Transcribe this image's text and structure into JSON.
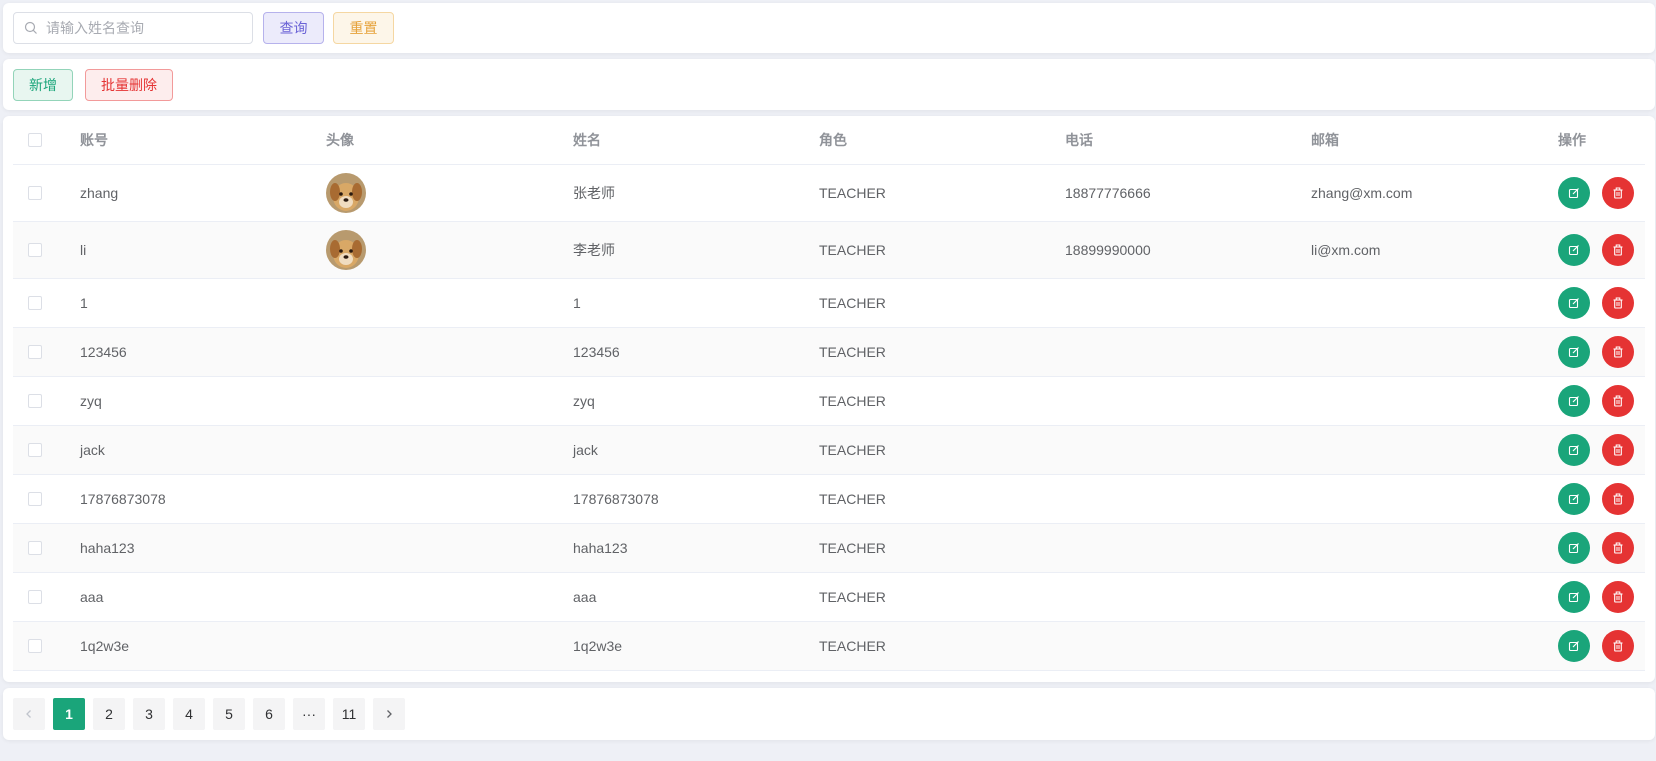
{
  "search": {
    "placeholder": "请输入姓名查询",
    "value": "",
    "search_label": "查询",
    "reset_label": "重置"
  },
  "actions": {
    "add_label": "新增",
    "batch_delete_label": "批量删除"
  },
  "table": {
    "columns": [
      "账号",
      "头像",
      "姓名",
      "角色",
      "电话",
      "邮箱",
      "操作"
    ],
    "rows": [
      {
        "account": "zhang",
        "avatar": "dog-photo",
        "name": "张老师",
        "role": "TEACHER",
        "phone": "18877776666",
        "email": "zhang@xm.com"
      },
      {
        "account": "li",
        "avatar": "dog-photo",
        "name": "李老师",
        "role": "TEACHER",
        "phone": "18899990000",
        "email": "li@xm.com"
      },
      {
        "account": "1",
        "avatar": "",
        "name": "1",
        "role": "TEACHER",
        "phone": "",
        "email": ""
      },
      {
        "account": "123456",
        "avatar": "",
        "name": "123456",
        "role": "TEACHER",
        "phone": "",
        "email": ""
      },
      {
        "account": "zyq",
        "avatar": "",
        "name": "zyq",
        "role": "TEACHER",
        "phone": "",
        "email": ""
      },
      {
        "account": "jack",
        "avatar": "",
        "name": "jack",
        "role": "TEACHER",
        "phone": "",
        "email": ""
      },
      {
        "account": "17876873078",
        "avatar": "",
        "name": "17876873078",
        "role": "TEACHER",
        "phone": "",
        "email": ""
      },
      {
        "account": "haha123",
        "avatar": "",
        "name": "haha123",
        "role": "TEACHER",
        "phone": "",
        "email": ""
      },
      {
        "account": "aaa",
        "avatar": "",
        "name": "aaa",
        "role": "TEACHER",
        "phone": "",
        "email": ""
      },
      {
        "account": "1q2w3e",
        "avatar": "",
        "name": "1q2w3e",
        "role": "TEACHER",
        "phone": "",
        "email": ""
      }
    ]
  },
  "pagination": {
    "pages": [
      "1",
      "2",
      "3",
      "4",
      "5",
      "6",
      "···",
      "11"
    ],
    "current": "1"
  },
  "icons": {
    "search": "search-icon",
    "edit": "edit-icon",
    "delete": "trash-icon",
    "prev": "chevron-left-icon",
    "next": "chevron-right-icon"
  },
  "colors": {
    "primary": "#1aa57a",
    "danger": "#e53333",
    "search_button": "#6a62d6",
    "reset_button": "#e6a33c",
    "background": "#eef0f6"
  }
}
